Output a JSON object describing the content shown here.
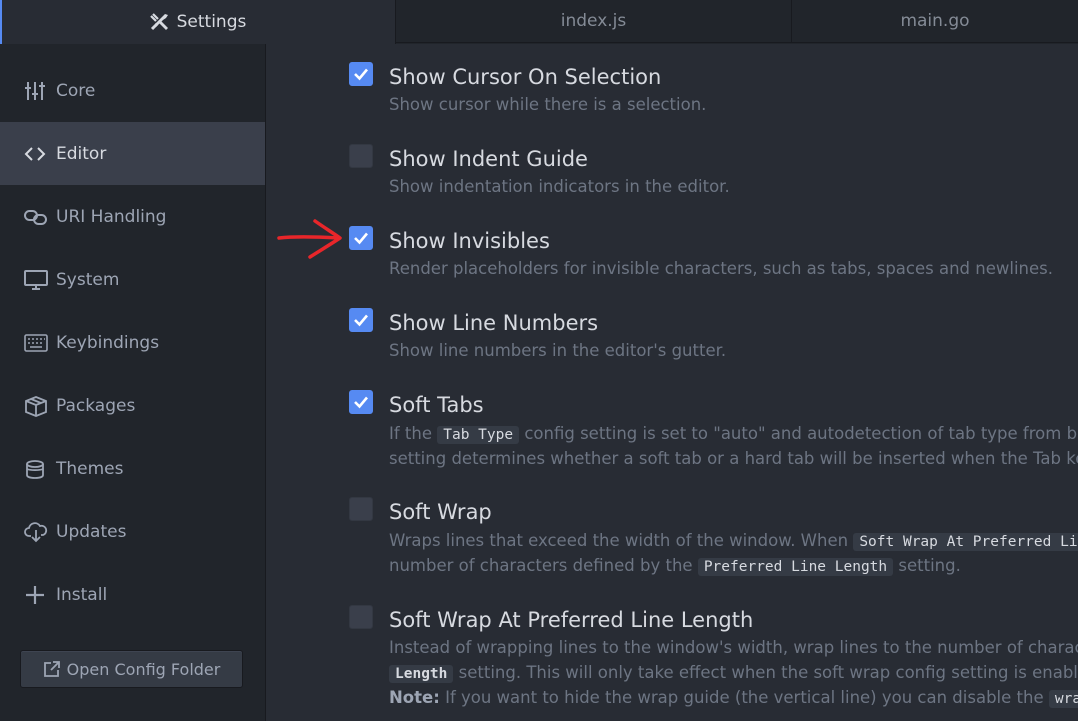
{
  "tabs": [
    {
      "label": "Settings",
      "icon": "tools-icon",
      "active": true
    },
    {
      "label": "index.js"
    },
    {
      "label": "main.go"
    }
  ],
  "sidebar": {
    "items": [
      {
        "label": "Core",
        "icon": "sliders-icon"
      },
      {
        "label": "Editor",
        "icon": "code-icon",
        "active": true
      },
      {
        "label": "URI Handling",
        "icon": "link-icon"
      },
      {
        "label": "System",
        "icon": "monitor-icon"
      },
      {
        "label": "Keybindings",
        "icon": "keyboard-icon"
      },
      {
        "label": "Packages",
        "icon": "package-icon"
      },
      {
        "label": "Themes",
        "icon": "paintcan-icon"
      },
      {
        "label": "Updates",
        "icon": "cloud-download-icon"
      },
      {
        "label": "Install",
        "icon": "plus-icon"
      }
    ],
    "open_config_label": "Open Config Folder"
  },
  "settings": {
    "show_cursor_on_selection": {
      "title": "Show Cursor On Selection",
      "desc": "Show cursor while there is a selection.",
      "checked": true
    },
    "show_indent_guide": {
      "title": "Show Indent Guide",
      "desc": "Show indentation indicators in the editor.",
      "checked": false
    },
    "show_invisibles": {
      "title": "Show Invisibles",
      "desc": "Render placeholders for invisible characters, such as tabs, spaces and newlines.",
      "checked": true
    },
    "show_line_numbers": {
      "title": "Show Line Numbers",
      "desc": "Show line numbers in the editor's gutter.",
      "checked": true
    },
    "soft_tabs": {
      "title": "Soft Tabs",
      "desc1_a": "If the",
      "desc1_code": "Tab Type",
      "desc1_b": "config setting is set to \"auto\" and autodetection of tab type from buffe",
      "desc2": "setting determines whether a soft tab or a hard tab will be inserted when the Tab key is",
      "checked": true
    },
    "soft_wrap": {
      "title": "Soft Wrap",
      "desc1_a": "Wraps lines that exceed the width of the window. When",
      "desc1_code": "Soft Wrap At Preferred Line",
      "desc2_a": "number of characters defined by the",
      "desc2_code": "Preferred Line Length",
      "desc2_b": "setting.",
      "checked": false
    },
    "soft_wrap_at_preferred_line_length": {
      "title": "Soft Wrap At Preferred Line Length",
      "desc1": "Instead of wrapping lines to the window's width, wrap lines to the number of characters",
      "desc2_code": "Length",
      "desc2_b": "setting. This will only take effect when the soft wrap config setting is enabled g",
      "desc3_bold": "Note:",
      "desc3_b": "If you want to hide the wrap guide (the vertical line) you can disable the",
      "desc3_code": "wrap-gu",
      "checked": false
    }
  },
  "colors": {
    "accent": "#568af2",
    "annotation_arrow": "#e8262a"
  }
}
